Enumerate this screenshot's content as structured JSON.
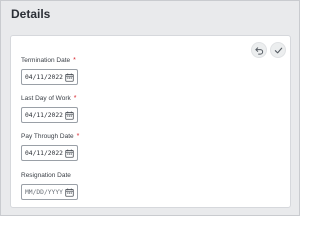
{
  "section": {
    "title": "Details"
  },
  "toolbar": {
    "undo_icon": "undo-icon",
    "save_icon": "check-icon"
  },
  "fields": [
    {
      "label": "Termination Date",
      "required": "*",
      "value": "04/11/2022"
    },
    {
      "label": "Last Day of Work",
      "required": "*",
      "value": "04/11/2022"
    },
    {
      "label": "Pay Through Date",
      "required": "*",
      "value": "04/11/2022"
    },
    {
      "label": "Resignation Date",
      "placeholder": "MM/DD/YYYY"
    }
  ],
  "colors": {
    "required": "#d9262e",
    "background": "#e9eaec",
    "card": "#ffffff"
  }
}
